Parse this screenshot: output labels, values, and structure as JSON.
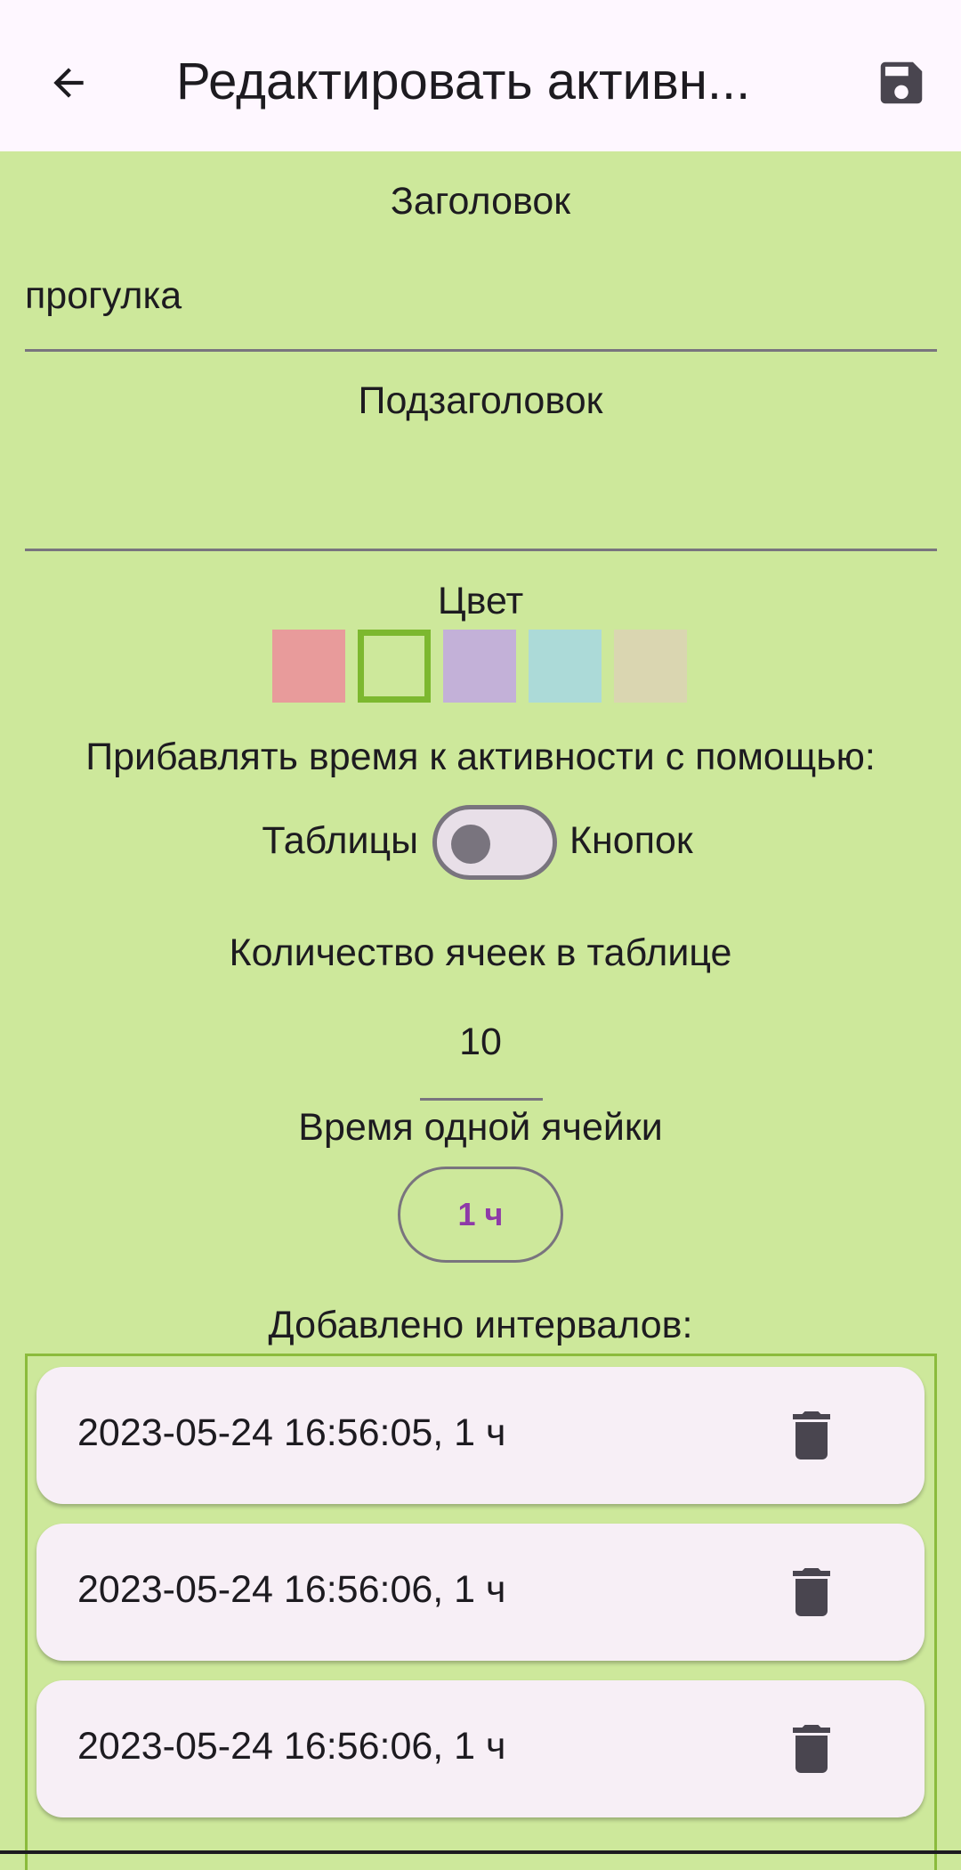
{
  "appbar": {
    "title": "Редактировать активн...",
    "back_icon": "arrow-left-icon",
    "save_icon": "floppy-disk-icon"
  },
  "title_field": {
    "label": "Заголовок",
    "value": "прогулка"
  },
  "subtitle_field": {
    "label": "Подзаголовок",
    "value": ""
  },
  "color_picker": {
    "label": "Цвет",
    "colors": [
      "#e89b9b",
      "#cde89b",
      "#c3b1d8",
      "#acdad8",
      "#dad6b1"
    ],
    "selected_index": 1,
    "selected_border": "#7cb82f"
  },
  "add_time": {
    "label": "Прибавлять время к активности с помощью:",
    "left_option": "Таблицы",
    "right_option": "Кнопок"
  },
  "cell_count": {
    "label": "Количество ячеек в таблице",
    "value": "10"
  },
  "cell_time": {
    "label": "Время одной ячейки",
    "value": "1 ч"
  },
  "intervals": {
    "label": "Добавлено интервалов:",
    "items": [
      {
        "text": "2023-05-24 16:56:05, 1 ч"
      },
      {
        "text": "2023-05-24 16:56:06, 1 ч"
      },
      {
        "text": "2023-05-24 16:56:06, 1 ч"
      }
    ]
  },
  "colors": {
    "background": "#cde89b",
    "appbar": "#fef7ff",
    "accent": "#8e3aa8",
    "card": "#f7eff6"
  }
}
